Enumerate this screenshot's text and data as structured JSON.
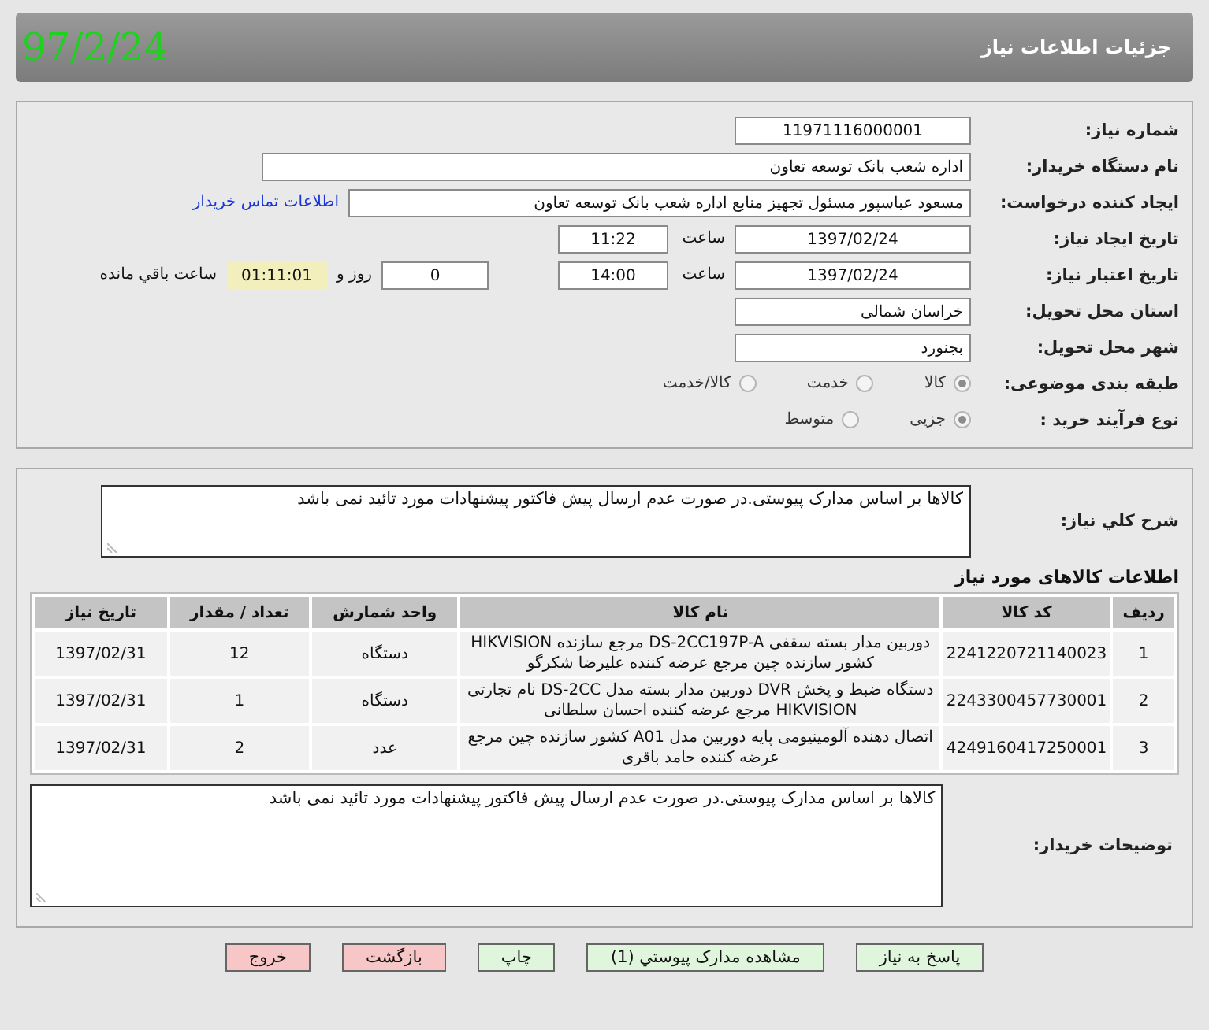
{
  "date_stamp": "97/2/24",
  "header": {
    "title": "جزئیات اطلاعات نیاز"
  },
  "need_number": {
    "label": "شماره نیاز:",
    "value": "11971116000001"
  },
  "buyer_org": {
    "label": "نام دستگاه خریدار:",
    "value": "اداره شعب بانک توسعه تعاون"
  },
  "requester": {
    "label": "ایجاد کننده درخواست:",
    "value": "مسعود عباسپور مسئول تجهیز منابع  اداره شعب بانک توسعه تعاون",
    "link": "اطلاعات تماس خریدار"
  },
  "created": {
    "label": "تاریخ ایجاد نیاز:",
    "date": "1397/02/24",
    "time_label": "ساعت",
    "time": "11:22"
  },
  "validity": {
    "label": "تاریخ اعتبار نیاز:",
    "date": "1397/02/24",
    "time_label": "ساعت",
    "time": "14:00",
    "days": "0",
    "days_label": "روز و",
    "remaining": "01:11:01",
    "remaining_label": "ساعت باقي مانده"
  },
  "province": {
    "label": "استان محل تحویل:",
    "value": "خراسان شمالی"
  },
  "city": {
    "label": "شهر محل تحویل:",
    "value": "بجنورد"
  },
  "category": {
    "label": "طبقه بندی موضوعی:",
    "options": [
      {
        "label": "کالا",
        "selected": true
      },
      {
        "label": "خدمت",
        "selected": false
      },
      {
        "label": "کالا/خدمت",
        "selected": false
      }
    ]
  },
  "process": {
    "label": "نوع فرآیند خرید :",
    "options": [
      {
        "label": "جزیی",
        "selected": true
      },
      {
        "label": "متوسط",
        "selected": false
      }
    ]
  },
  "description": {
    "label": "شرح کلي نياز:",
    "text": "کالاها بر اساس مدارک پیوستی.در صورت عدم ارسال پیش فاکتور پیشنهادات مورد تائید نمی باشد"
  },
  "items": {
    "title": "اطلاعات کالاهای مورد نیاز",
    "columns": [
      "ردیف",
      "کد کالا",
      "نام کالا",
      "واحد شمارش",
      "تعداد / مقدار",
      "تاریخ نیاز"
    ],
    "rows": [
      [
        "1",
        "2241220721140023",
        "دوربین مدار بسته سقفی DS-2CC197P-A مرجع سازنده HIKVISION کشور سازنده چین مرجع عرضه کننده علیرضا شکرگو",
        "دستگاه",
        "12",
        "1397/02/31"
      ],
      [
        "2",
        "2243300457730001",
        "دستگاه ضبط و پخش DVR دوربین مدار بسته مدل DS-2CC نام تجارتی HIKVISION مرجع عرضه کننده احسان سلطانی",
        "دستگاه",
        "1",
        "1397/02/31"
      ],
      [
        "3",
        "4249160417250001",
        "اتصال دهنده آلومینیومی پایه دوربین مدل A01 کشور سازنده چین مرجع عرضه کننده حامد باقری",
        "عدد",
        "2",
        "1397/02/31"
      ]
    ]
  },
  "buyer_notes": {
    "label": "توضیحات خریدار:",
    "text": "کالاها بر اساس مدارک پیوستی.در صورت عدم ارسال پیش فاکتور پیشنهادات مورد تائید نمی باشد"
  },
  "buttons": [
    {
      "label": "پاسخ به نیاز",
      "kind": "normal"
    },
    {
      "label": "مشاهده مدارک پیوستي (1)",
      "kind": "normal"
    },
    {
      "label": "چاپ",
      "kind": "normal"
    },
    {
      "label": "بازگشت",
      "kind": "danger"
    },
    {
      "label": "خروج",
      "kind": "danger"
    }
  ]
}
